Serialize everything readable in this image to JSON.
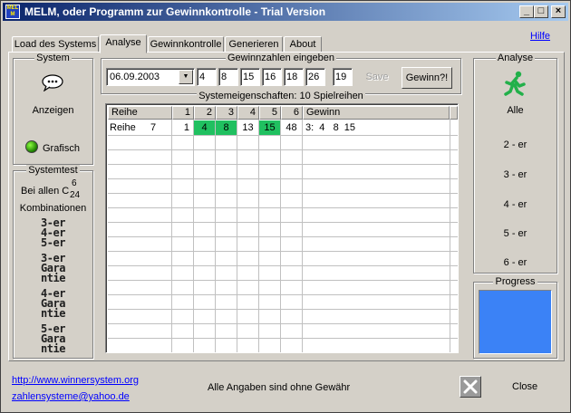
{
  "window": {
    "title": "MELM, oder Programm zur Gewinnkontrolle - Trial Version",
    "icon_text": "MELM",
    "controls": {
      "minimize": "_",
      "maximize": "□",
      "close": "×"
    }
  },
  "tabs": [
    {
      "label": "Load des Systems"
    },
    {
      "label": "Analyse"
    },
    {
      "label": "Gewinnkontrolle"
    },
    {
      "label": "Generieren"
    },
    {
      "label": "About"
    }
  ],
  "help_link": "Hilfe",
  "left_panel": {
    "system_title": "System",
    "anzeigen": "Anzeigen",
    "grafisch": "Grafisch",
    "systemtest_title": "Systemtest",
    "bei_allen": "Bei allen C",
    "c_top": "6",
    "c_bottom": "24",
    "kombinationen": "Kombinationen",
    "items": [
      "3-er",
      "4-er",
      "5-er",
      "3-er Garantie",
      "4-er Garantie",
      "5-er Garantie"
    ],
    "garantie_items": [
      {
        "line1": "3-er",
        "line2": "Gara",
        "line3": "ntie"
      },
      {
        "line1": "4-er",
        "line2": "Gara",
        "line3": "ntie"
      },
      {
        "line1": "5-er",
        "line2": "Gara",
        "line3": "ntie"
      }
    ]
  },
  "input_group": {
    "title": "Gewinnzahlen eingeben",
    "date": "06.09.2003",
    "numbers": [
      "4",
      "8",
      "15",
      "16",
      "18",
      "26"
    ],
    "zusatz": "19",
    "save_label": "Save",
    "gewinn_label": "Gewinn?!"
  },
  "table": {
    "title": "Systemeigenschaften: 10 Spielreihen",
    "headers": [
      "Reihe",
      "1",
      "2",
      "3",
      "4",
      "5",
      "6",
      "Gewinn"
    ],
    "rows": [
      {
        "reihe": "Reihe",
        "nr": "7",
        "cells": [
          "1",
          "4",
          "8",
          "13",
          "15",
          "48"
        ],
        "hits": [
          false,
          true,
          true,
          false,
          true,
          false
        ],
        "gewinn": "3:  4   8  15"
      }
    ]
  },
  "right_panel": {
    "title": "Analyse",
    "alle": "Alle",
    "items": [
      "2 - er",
      "3 - er",
      "4 - er",
      "5 - er",
      "6 - er"
    ],
    "progress_title": "Progress",
    "progress_color": "#3b82f6"
  },
  "footer": {
    "url": "http://www.winnersystem.org",
    "email": "zahlensysteme@yahoo.de",
    "disclaimer": "Alle Angaben sind ohne Gewähr",
    "close_label": "Close"
  }
}
